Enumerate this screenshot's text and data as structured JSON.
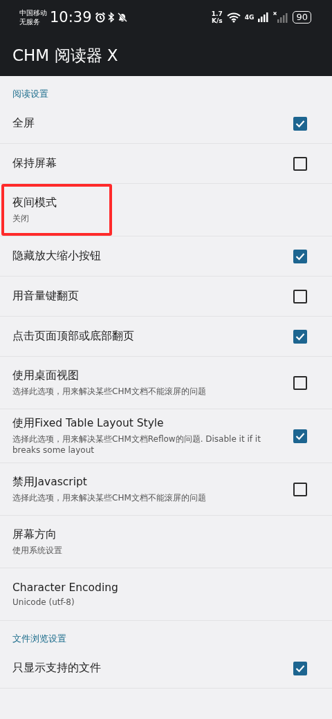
{
  "status_bar": {
    "carrier": "中国移动",
    "service": "无服务",
    "time": "10:39",
    "speed": "1.7",
    "speed_unit": "K/s",
    "network": "4G",
    "battery": "90"
  },
  "app_bar": {
    "title": "CHM 阅读器 X"
  },
  "sections": [
    {
      "header": "阅读设置",
      "items": [
        {
          "kind": "checkbox",
          "title": "全屏",
          "checked": true
        },
        {
          "kind": "checkbox",
          "title": "保持屏幕",
          "checked": false
        },
        {
          "kind": "plain",
          "title": "夜间模式",
          "summary": "关闭",
          "highlighted": true
        },
        {
          "kind": "checkbox",
          "title": "隐藏放大缩小按钮",
          "checked": true
        },
        {
          "kind": "checkbox",
          "title": "用音量键翻页",
          "checked": false
        },
        {
          "kind": "checkbox",
          "title": "点击页面顶部或底部翻页",
          "checked": true
        },
        {
          "kind": "checkbox",
          "title": "使用桌面视图",
          "summary": "选择此选项，用来解决某些CHM文档不能滚屏的问题",
          "checked": false
        },
        {
          "kind": "checkbox",
          "title": "使用Fixed Table Layout Style",
          "summary": "选择此选项，用来解决某些CHM文档Reflow的问题. Disable it if it breaks some layout",
          "checked": true
        },
        {
          "kind": "checkbox",
          "title": "禁用Javascript",
          "summary": "选择此选项，用来解决某些CHM文档不能滚屏的问题",
          "checked": false
        },
        {
          "kind": "plain",
          "title": "屏幕方向",
          "summary": "使用系统设置"
        },
        {
          "kind": "plain",
          "title": "Character Encoding",
          "summary": "Unicode (utf-8)"
        }
      ]
    },
    {
      "header": "文件浏览设置",
      "items": [
        {
          "kind": "checkbox",
          "title": "只显示支持的文件",
          "checked": true
        }
      ]
    }
  ]
}
